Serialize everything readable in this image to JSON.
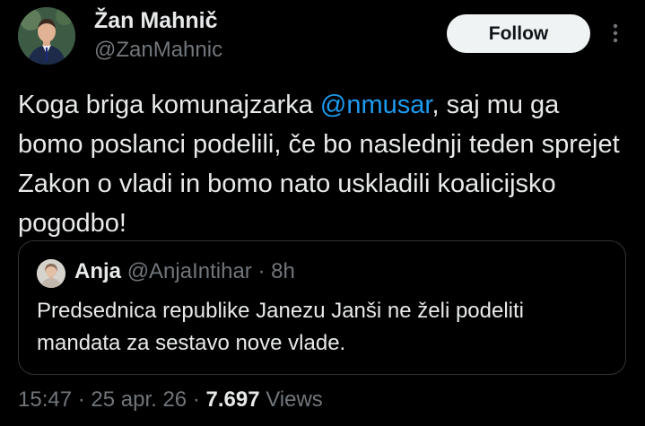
{
  "author": {
    "display_name": "Žan Mahnič",
    "handle": "@ZanMahnic"
  },
  "follow_label": "Follow",
  "tweet": {
    "text_before": "Koga briga komunajzarka ",
    "mention": "@nmusar",
    "text_after": ", saj mu ga bomo poslanci podelili, če bo naslednji teden sprejet Zakon o vladi in bomo nato uskladili koalicijsko pogodbo!"
  },
  "quote": {
    "name": "Anja",
    "handle": "@AnjaIntihar",
    "separator": " · ",
    "age": "8h",
    "text": "Predsednica republike Janezu Janši ne želi podeliti mandata za sestavo nove vlade."
  },
  "meta": {
    "time": "15:47",
    "date": "25 apr. 26",
    "separator": " · ",
    "views_count": "7.697",
    "views_label": "Views"
  },
  "colors": {
    "background": "#000000",
    "text": "#e7e9ea",
    "muted": "#71767b",
    "link": "#1d9bf0",
    "border": "#2f3336",
    "follow_bg": "#eff3f4"
  },
  "icons": {
    "more": "more-icon"
  }
}
